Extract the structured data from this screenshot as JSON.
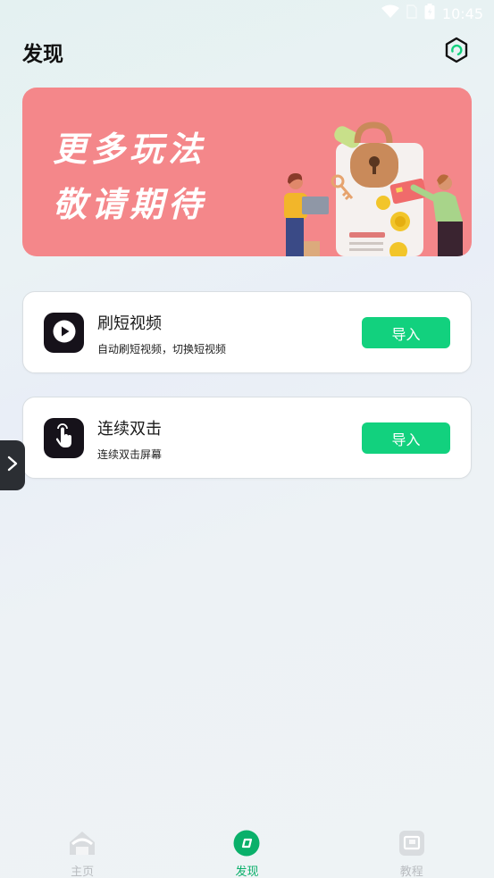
{
  "status_bar": {
    "time": "10:45",
    "icons": [
      "wifi-icon",
      "sim-icon",
      "battery-icon"
    ]
  },
  "header": {
    "title": "发现",
    "settings_icon": "hexagon-settings-icon"
  },
  "banner": {
    "line1": "更多玩法",
    "line2": "敬请期待",
    "color": "#f4878a"
  },
  "features": [
    {
      "title": "刷短视频",
      "desc": "自动刷短视频，切换短视频",
      "button": "导入",
      "icon": "play-icon"
    },
    {
      "title": "连续双击",
      "desc": "连续双击屏幕",
      "button": "导入",
      "icon": "tap-hand-icon"
    }
  ],
  "side_handle": {
    "icon": "chevron-right-icon"
  },
  "bottom_nav": {
    "items": [
      {
        "label": "主页",
        "icon": "home-icon",
        "active": false
      },
      {
        "label": "发现",
        "icon": "discover-icon",
        "active": true
      },
      {
        "label": "教程",
        "icon": "tutorial-icon",
        "active": false
      }
    ]
  },
  "colors": {
    "accent": "#12d17e",
    "active_nav": "#0ab06a",
    "icon_bg": "#16121a"
  }
}
